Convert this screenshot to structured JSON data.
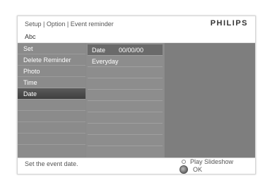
{
  "header": {
    "breadcrumb": "Setup | Option | Event reminder",
    "brand": "PHILIPS"
  },
  "subheader": {
    "text": "Abc"
  },
  "menu": {
    "items": [
      {
        "label": "Set",
        "selected": false
      },
      {
        "label": "Delete Reminder",
        "selected": false
      },
      {
        "label": "Photo",
        "selected": false
      },
      {
        "label": "Time",
        "selected": false
      },
      {
        "label": "Date",
        "selected": true
      }
    ]
  },
  "submenu": {
    "items": [
      {
        "label": "Date",
        "value": "00/00/00",
        "active": true
      },
      {
        "label": "Everyday",
        "value": "",
        "active": false
      }
    ]
  },
  "footer": {
    "hint": "Set the event date.",
    "play_label": "Play Slideshow",
    "ok_label": "OK"
  }
}
